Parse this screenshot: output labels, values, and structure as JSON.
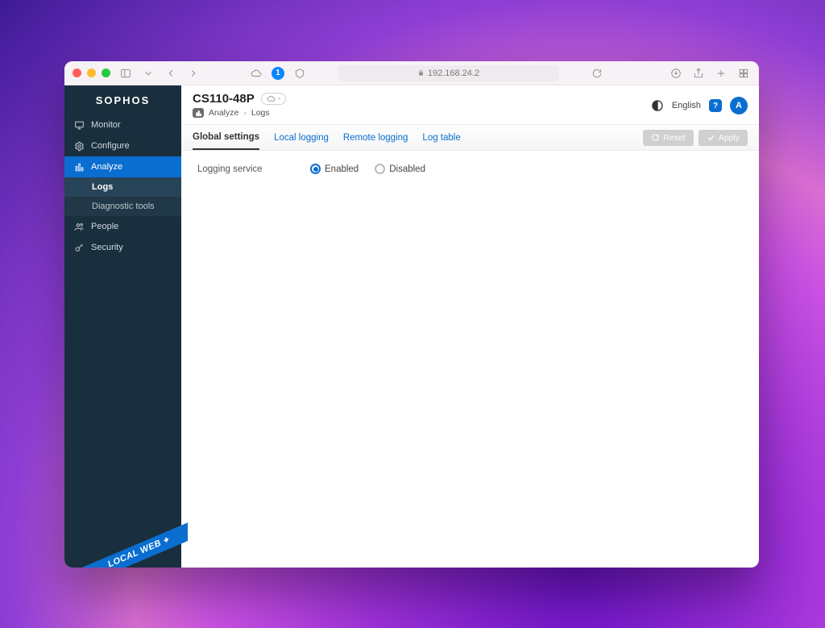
{
  "browser": {
    "url": "192.168.24.2",
    "onepass_badge": "1"
  },
  "brand": "SOPHOS",
  "sidebar": {
    "items": [
      {
        "label": "Monitor"
      },
      {
        "label": "Configure"
      },
      {
        "label": "Analyze"
      },
      {
        "label": "People"
      },
      {
        "label": "Security"
      }
    ],
    "analyze_sub": [
      {
        "label": "Logs"
      },
      {
        "label": "Diagnostic tools"
      }
    ],
    "ribbon": "LOCAL WEB ⌖"
  },
  "header": {
    "device": "CS110-48P",
    "cloud_count": "-",
    "crumb1": "Analyze",
    "crumb2": "Logs",
    "language": "English",
    "help": "?",
    "avatar": "A"
  },
  "tabs": [
    {
      "label": "Global settings"
    },
    {
      "label": "Local logging"
    },
    {
      "label": "Remote logging"
    },
    {
      "label": "Log table"
    }
  ],
  "actions": {
    "reset": "Reset",
    "apply": "Apply"
  },
  "form": {
    "logging_service_label": "Logging service",
    "enabled": "Enabled",
    "disabled": "Disabled"
  }
}
